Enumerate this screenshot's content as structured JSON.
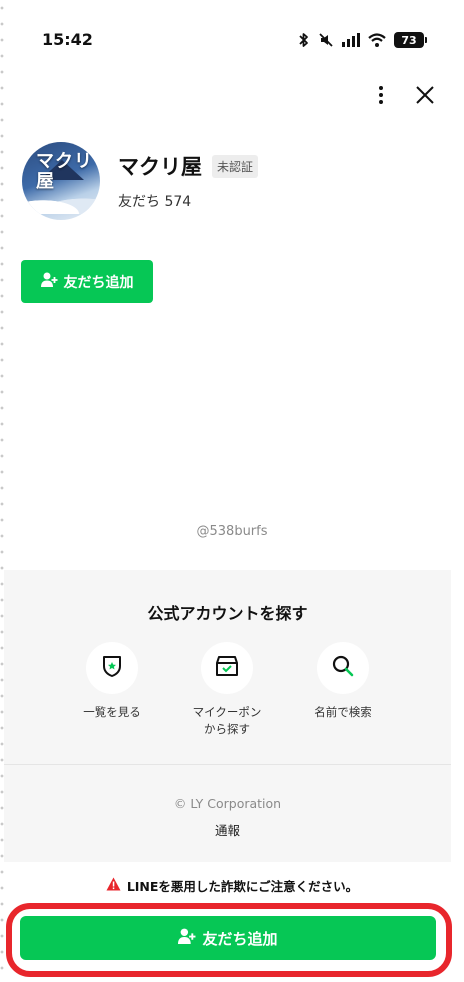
{
  "status_bar": {
    "time": "15:42",
    "battery": "73",
    "icons": [
      "bluetooth-icon",
      "mute-icon",
      "signal-icon",
      "wifi-icon",
      "battery-icon"
    ]
  },
  "header": {
    "more_icon": "more-vertical-icon",
    "close_icon": "close-icon"
  },
  "profile": {
    "avatar_text": "マクリ屋",
    "name": "マクリ屋",
    "badge": "未認証",
    "friends": "友だち 574"
  },
  "actions": {
    "add_friend_label": "友だち追加"
  },
  "account_id": "@538burfs",
  "explore": {
    "title": "公式アカウントを探す",
    "items": [
      {
        "label": "一覧を見る",
        "icon": "shield-star-icon"
      },
      {
        "label": "マイクーポン\nから探す",
        "icon": "coupon-box-icon"
      },
      {
        "label": "名前で検索",
        "icon": "search-icon"
      }
    ],
    "copyright": "© LY Corporation",
    "report": "通報"
  },
  "warning": {
    "text": "LINEを悪用した詐欺にご注意ください。",
    "icon": "warning-icon"
  },
  "bottom": {
    "add_friend_label": "友だち追加"
  },
  "colors": {
    "line_green": "#06c755",
    "highlight_red": "#e8262c",
    "warning_red": "#e8262c"
  }
}
